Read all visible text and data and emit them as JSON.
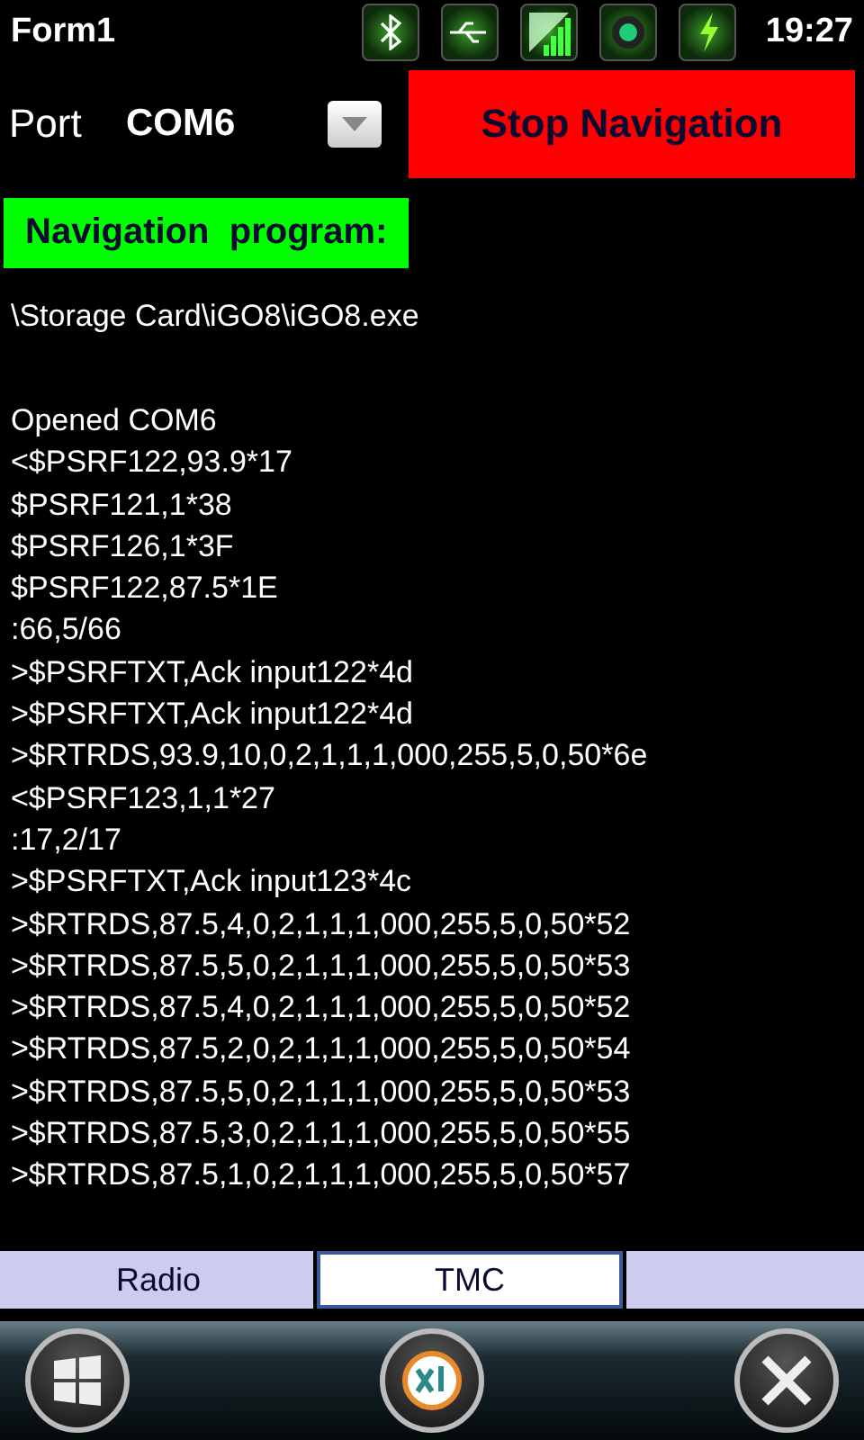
{
  "status_bar": {
    "title": "Form1",
    "time": "19:27"
  },
  "port": {
    "label": "Port",
    "value": "COM6"
  },
  "stop_button": "Stop Navigation",
  "program_label": "Navigation  program:",
  "program_path": "\\Storage Card\\iGO8\\iGO8.exe",
  "log": [
    "Opened COM6",
    "<$PSRF122,93.9*17",
    "$PSRF121,1*38",
    "$PSRF126,1*3F",
    "$PSRF122,87.5*1E",
    ":66,5/66",
    ">$PSRFTXT,Ack input122*4d",
    ">$PSRFTXT,Ack input122*4d",
    ">$RTRDS,93.9,10,0,2,1,1,1,000,255,5,0,50*6e",
    "<$PSRF123,1,1*27",
    ":17,2/17",
    ">$PSRFTXT,Ack input123*4c",
    ">$RTRDS,87.5,4,0,2,1,1,1,000,255,5,0,50*52",
    ">$RTRDS,87.5,5,0,2,1,1,1,000,255,5,0,50*53",
    ">$RTRDS,87.5,4,0,2,1,1,1,000,255,5,0,50*52",
    ">$RTRDS,87.5,2,0,2,1,1,1,000,255,5,0,50*54",
    ">$RTRDS,87.5,5,0,2,1,1,1,000,255,5,0,50*53",
    ">$RTRDS,87.5,3,0,2,1,1,1,000,255,5,0,50*55",
    ">$RTRDS,87.5,1,0,2,1,1,1,000,255,5,0,50*57"
  ],
  "tabs": [
    {
      "label": "Radio",
      "selected": false
    },
    {
      "label": "TMC",
      "selected": true
    }
  ]
}
